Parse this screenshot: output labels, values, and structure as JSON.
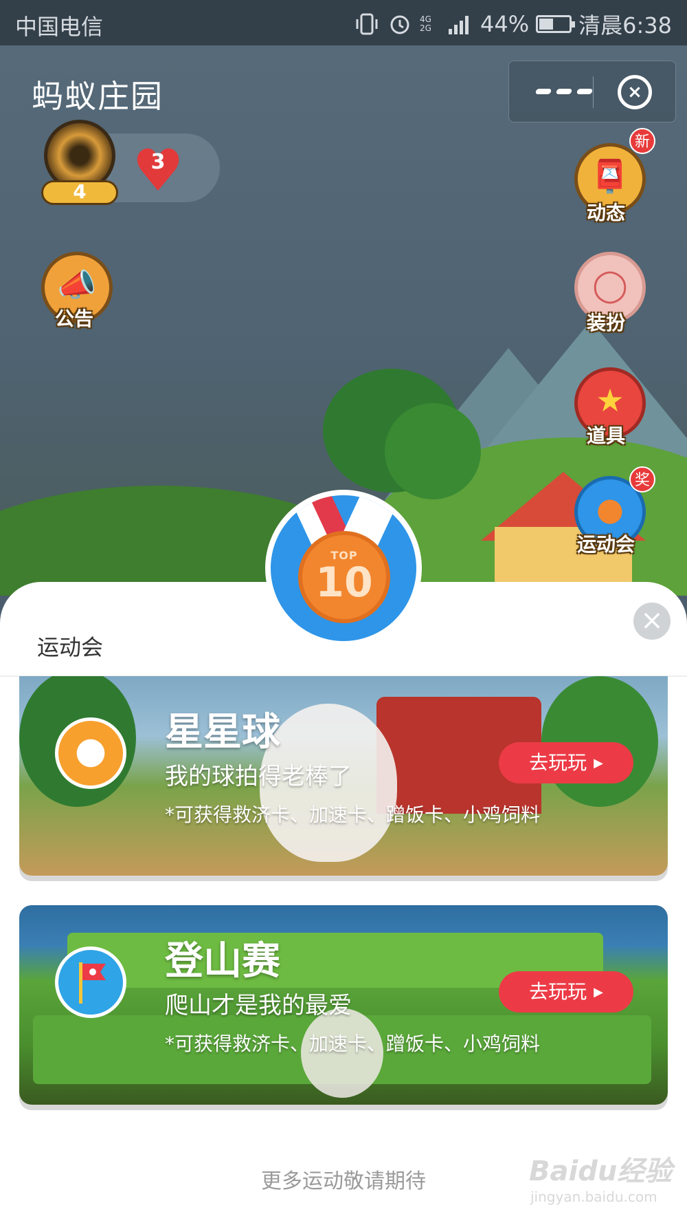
{
  "status_bar": {
    "carrier": "中国电信",
    "battery": "44%",
    "battery_level": 0.44,
    "time": "清晨6:38",
    "network": "4G 2G"
  },
  "header": {
    "title": "蚂蚁庄园",
    "more_icon": "more-dots-icon",
    "close_icon": "miniapp-close-icon"
  },
  "player": {
    "level": "4",
    "lives": "3"
  },
  "left_buttons": [
    {
      "label": "公告",
      "icon": "megaphone-icon"
    }
  ],
  "right_buttons": [
    {
      "label": "动态",
      "icon": "mailbox-icon",
      "badge": "新"
    },
    {
      "label": "装扮",
      "icon": "mirror-icon",
      "badge": ""
    },
    {
      "label": "道具",
      "icon": "star-icon",
      "badge": ""
    },
    {
      "label": "运动会",
      "icon": "medal-icon",
      "badge": "奖"
    }
  ],
  "sheet": {
    "title": "运动会",
    "medal": {
      "top": "TOP",
      "number": "10"
    },
    "games": [
      {
        "title": "星星球",
        "subtitle": "我的球拍得老棒了",
        "rewards": "*可获得救济卡、加速卡、蹭饭卡、小鸡饲料",
        "button": "去玩玩",
        "icon": "beach-ball-icon"
      },
      {
        "title": "登山赛",
        "subtitle": "爬山才是我的最爱",
        "rewards": "*可获得救济卡、加速卡、蹭饭卡、小鸡饲料",
        "button": "去玩玩",
        "icon": "flag-icon"
      }
    ],
    "footer": "更多运动敬请期待"
  },
  "watermark": {
    "text": "Baidu经验",
    "sub": "jingyan.baidu.com"
  },
  "colors": {
    "accent_red": "#ec3b46",
    "medal_blue": "#2e95e8",
    "medal_orange": "#f2862f"
  }
}
